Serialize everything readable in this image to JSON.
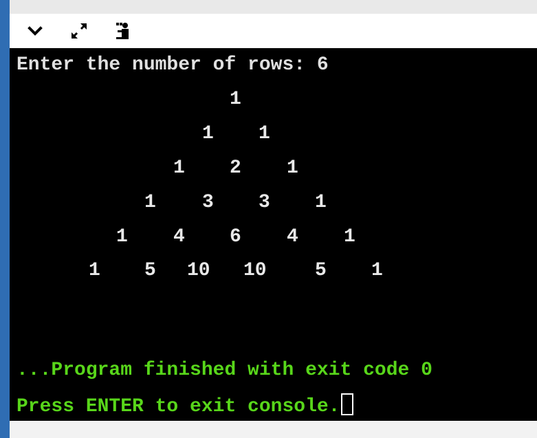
{
  "toolbar": {
    "buttons": [
      {
        "icon": "chevron-down-icon"
      },
      {
        "icon": "expand-icon"
      },
      {
        "icon": "person-icon"
      }
    ]
  },
  "console": {
    "prompt": "Enter the number of rows: 6",
    "triangle": [
      [
        "1"
      ],
      [
        "1",
        "1"
      ],
      [
        "1",
        "2",
        "1"
      ],
      [
        "1",
        "3",
        "3",
        "1"
      ],
      [
        "1",
        "4",
        "6",
        "4",
        "1"
      ],
      [
        "1",
        "5",
        "10",
        "10",
        "5",
        "1"
      ]
    ],
    "finish_message": "...Program finished with exit code 0",
    "exit_prompt": "Press ENTER to exit console."
  },
  "colors": {
    "console_bg": "#000000",
    "output_text": "#e0e0e0",
    "status_text": "#58d61a",
    "left_accent": "#2f6db3"
  }
}
